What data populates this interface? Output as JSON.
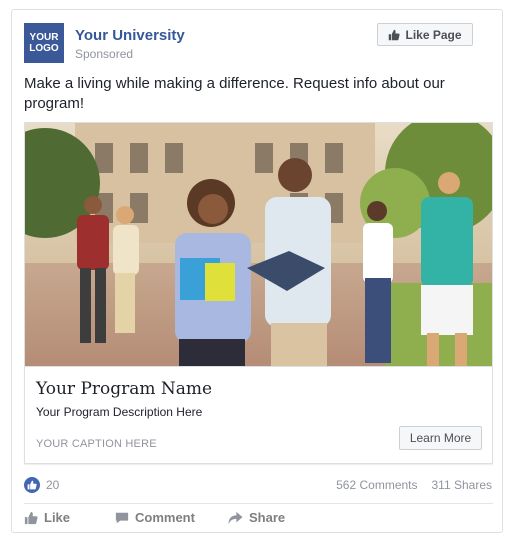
{
  "header": {
    "logo_line1": "YOUR",
    "logo_line2": "LOGO",
    "page_name": "Your University",
    "sponsored": "Sponsored",
    "like_page_label": "Like Page"
  },
  "post": {
    "text": "Make a living while making a difference. Request info about our program!"
  },
  "link": {
    "program_name": "Your Program Name",
    "program_description": "Your Program Description Here",
    "caption": "YOUR CAPTION HERE",
    "cta_label": "Learn More"
  },
  "engagement": {
    "likes": "20",
    "comments": "562 Comments",
    "shares": "311 Shares"
  },
  "actions": {
    "like": "Like",
    "comment": "Comment",
    "share": "Share"
  },
  "colors": {
    "brand": "#3b5998",
    "link_blue": "#365899",
    "like_badge": "#4267b2"
  },
  "icons": [
    "thumbs-up-icon",
    "comment-icon",
    "share-icon"
  ]
}
